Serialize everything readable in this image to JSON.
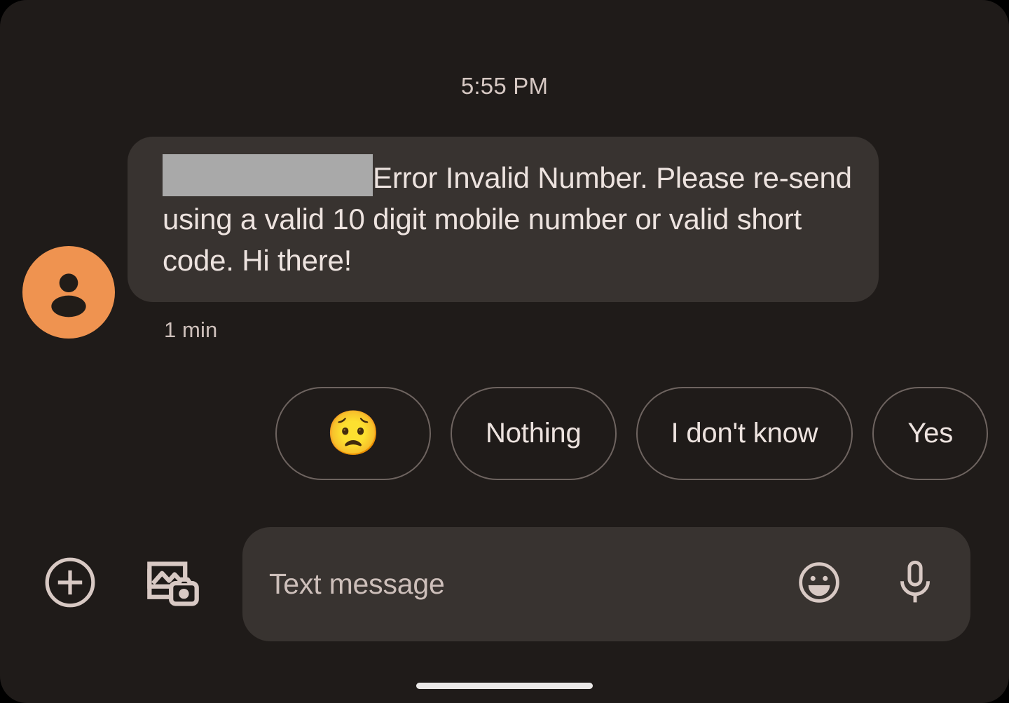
{
  "conversation": {
    "timestamp": "5:55 PM",
    "message": {
      "redacted_label": "redacted-sender-prefix",
      "text": "Error Invalid Number. Please re-send using a valid 10 digit mobile number or valid short code. Hi there!",
      "status": "1 min",
      "avatar_icon": "person-icon",
      "avatar_color": "#EF9350",
      "bubble_color": "#383330",
      "redaction_color": "#A9A9A9"
    }
  },
  "suggestions": {
    "chips": [
      {
        "label": "😟",
        "name": "worried-face-emoji"
      },
      {
        "label": "Nothing",
        "name": "nothing"
      },
      {
        "label": "I don't know",
        "name": "i-dont-know"
      },
      {
        "label": "Yes",
        "name": "yes"
      }
    ],
    "border_color": "#6E6460"
  },
  "composer": {
    "attach_icon": "plus-circle-icon",
    "gallery_icon": "photo-gallery-camera-icon",
    "placeholder": "Text message",
    "value": "",
    "emoji_icon": "emoji-smiley-icon",
    "mic_icon": "microphone-icon"
  },
  "system": {
    "nav_handle": "gesture-navigation-handle",
    "background_color": "#1F1B19",
    "text_color": "#EDE3DF"
  }
}
